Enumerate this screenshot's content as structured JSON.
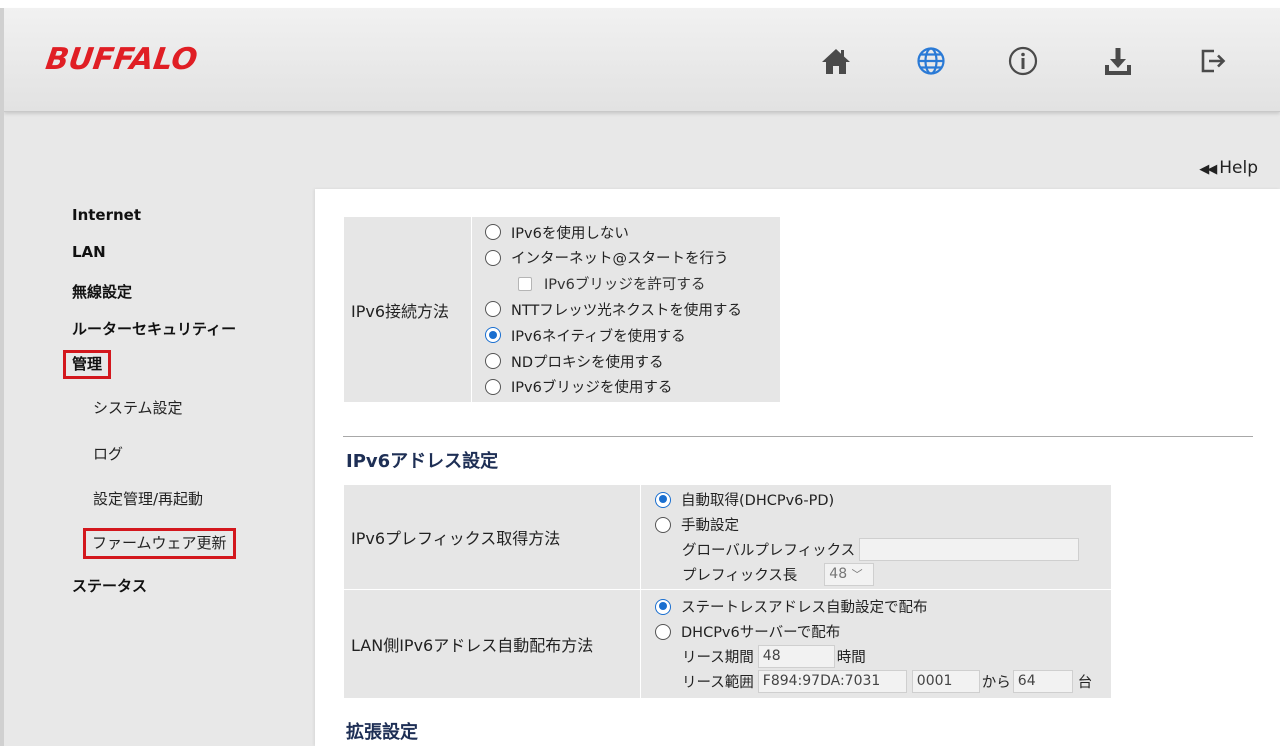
{
  "header": {
    "brand": "BUFFALO",
    "icons": [
      "home-icon",
      "globe-icon",
      "info-icon",
      "download-icon",
      "logout-icon"
    ],
    "accent_color": "#2a7ad6",
    "brand_color": "#e01e24"
  },
  "help": {
    "label": "Help"
  },
  "sidebar": {
    "items": [
      {
        "label": "Internet"
      },
      {
        "label": "LAN"
      },
      {
        "label": "無線設定"
      },
      {
        "label": "ルーターセキュリティー"
      },
      {
        "label": "管理"
      },
      {
        "label": "ステータス"
      }
    ],
    "sub_items": [
      {
        "label": "システム設定"
      },
      {
        "label": "ログ"
      },
      {
        "label": "設定管理/再起動"
      },
      {
        "label": "ファームウェア更新"
      }
    ],
    "highlight_color": "#d3171d"
  },
  "ipv6": {
    "label": "IPv6接続方法",
    "options": [
      {
        "label": "IPv6を使用しない",
        "selected": false
      },
      {
        "label": "インターネット@スタートを行う",
        "selected": false
      },
      {
        "label": "IPv6ブリッジを許可する",
        "checkbox": true,
        "checked": false
      },
      {
        "label": "NTTフレッツ光ネクストを使用する",
        "selected": false
      },
      {
        "label": "IPv6ネイティブを使用する",
        "selected": true
      },
      {
        "label": "NDプロキシを使用する",
        "selected": false
      },
      {
        "label": "IPv6ブリッジを使用する",
        "selected": false
      }
    ]
  },
  "address": {
    "title": "IPv6アドレス設定",
    "prefix": {
      "label": "IPv6プレフィックス取得方法",
      "auto": "自動取得(DHCPv6-PD)",
      "manual": "手動設定",
      "global_prefix_label": "グローバルプレフィックス",
      "global_prefix_value": "",
      "prefix_length_label": "プレフィックス長",
      "prefix_length_value": "48"
    },
    "lan": {
      "label": "LAN側IPv6アドレス自動配布方法",
      "stateless": "ステートレスアドレス自動設定で配布",
      "dhcp": "DHCPv6サーバーで配布",
      "lease_period_label": "リース期間",
      "lease_period_value": "48",
      "lease_period_unit": "時間",
      "lease_range_label": "リース範囲",
      "lease_range_prefix": "F894:97DA:7031",
      "lease_range_start": "0001",
      "from_label": "から",
      "lease_range_count": "64",
      "count_unit": "台"
    }
  },
  "extended": {
    "title": "拡張設定"
  }
}
